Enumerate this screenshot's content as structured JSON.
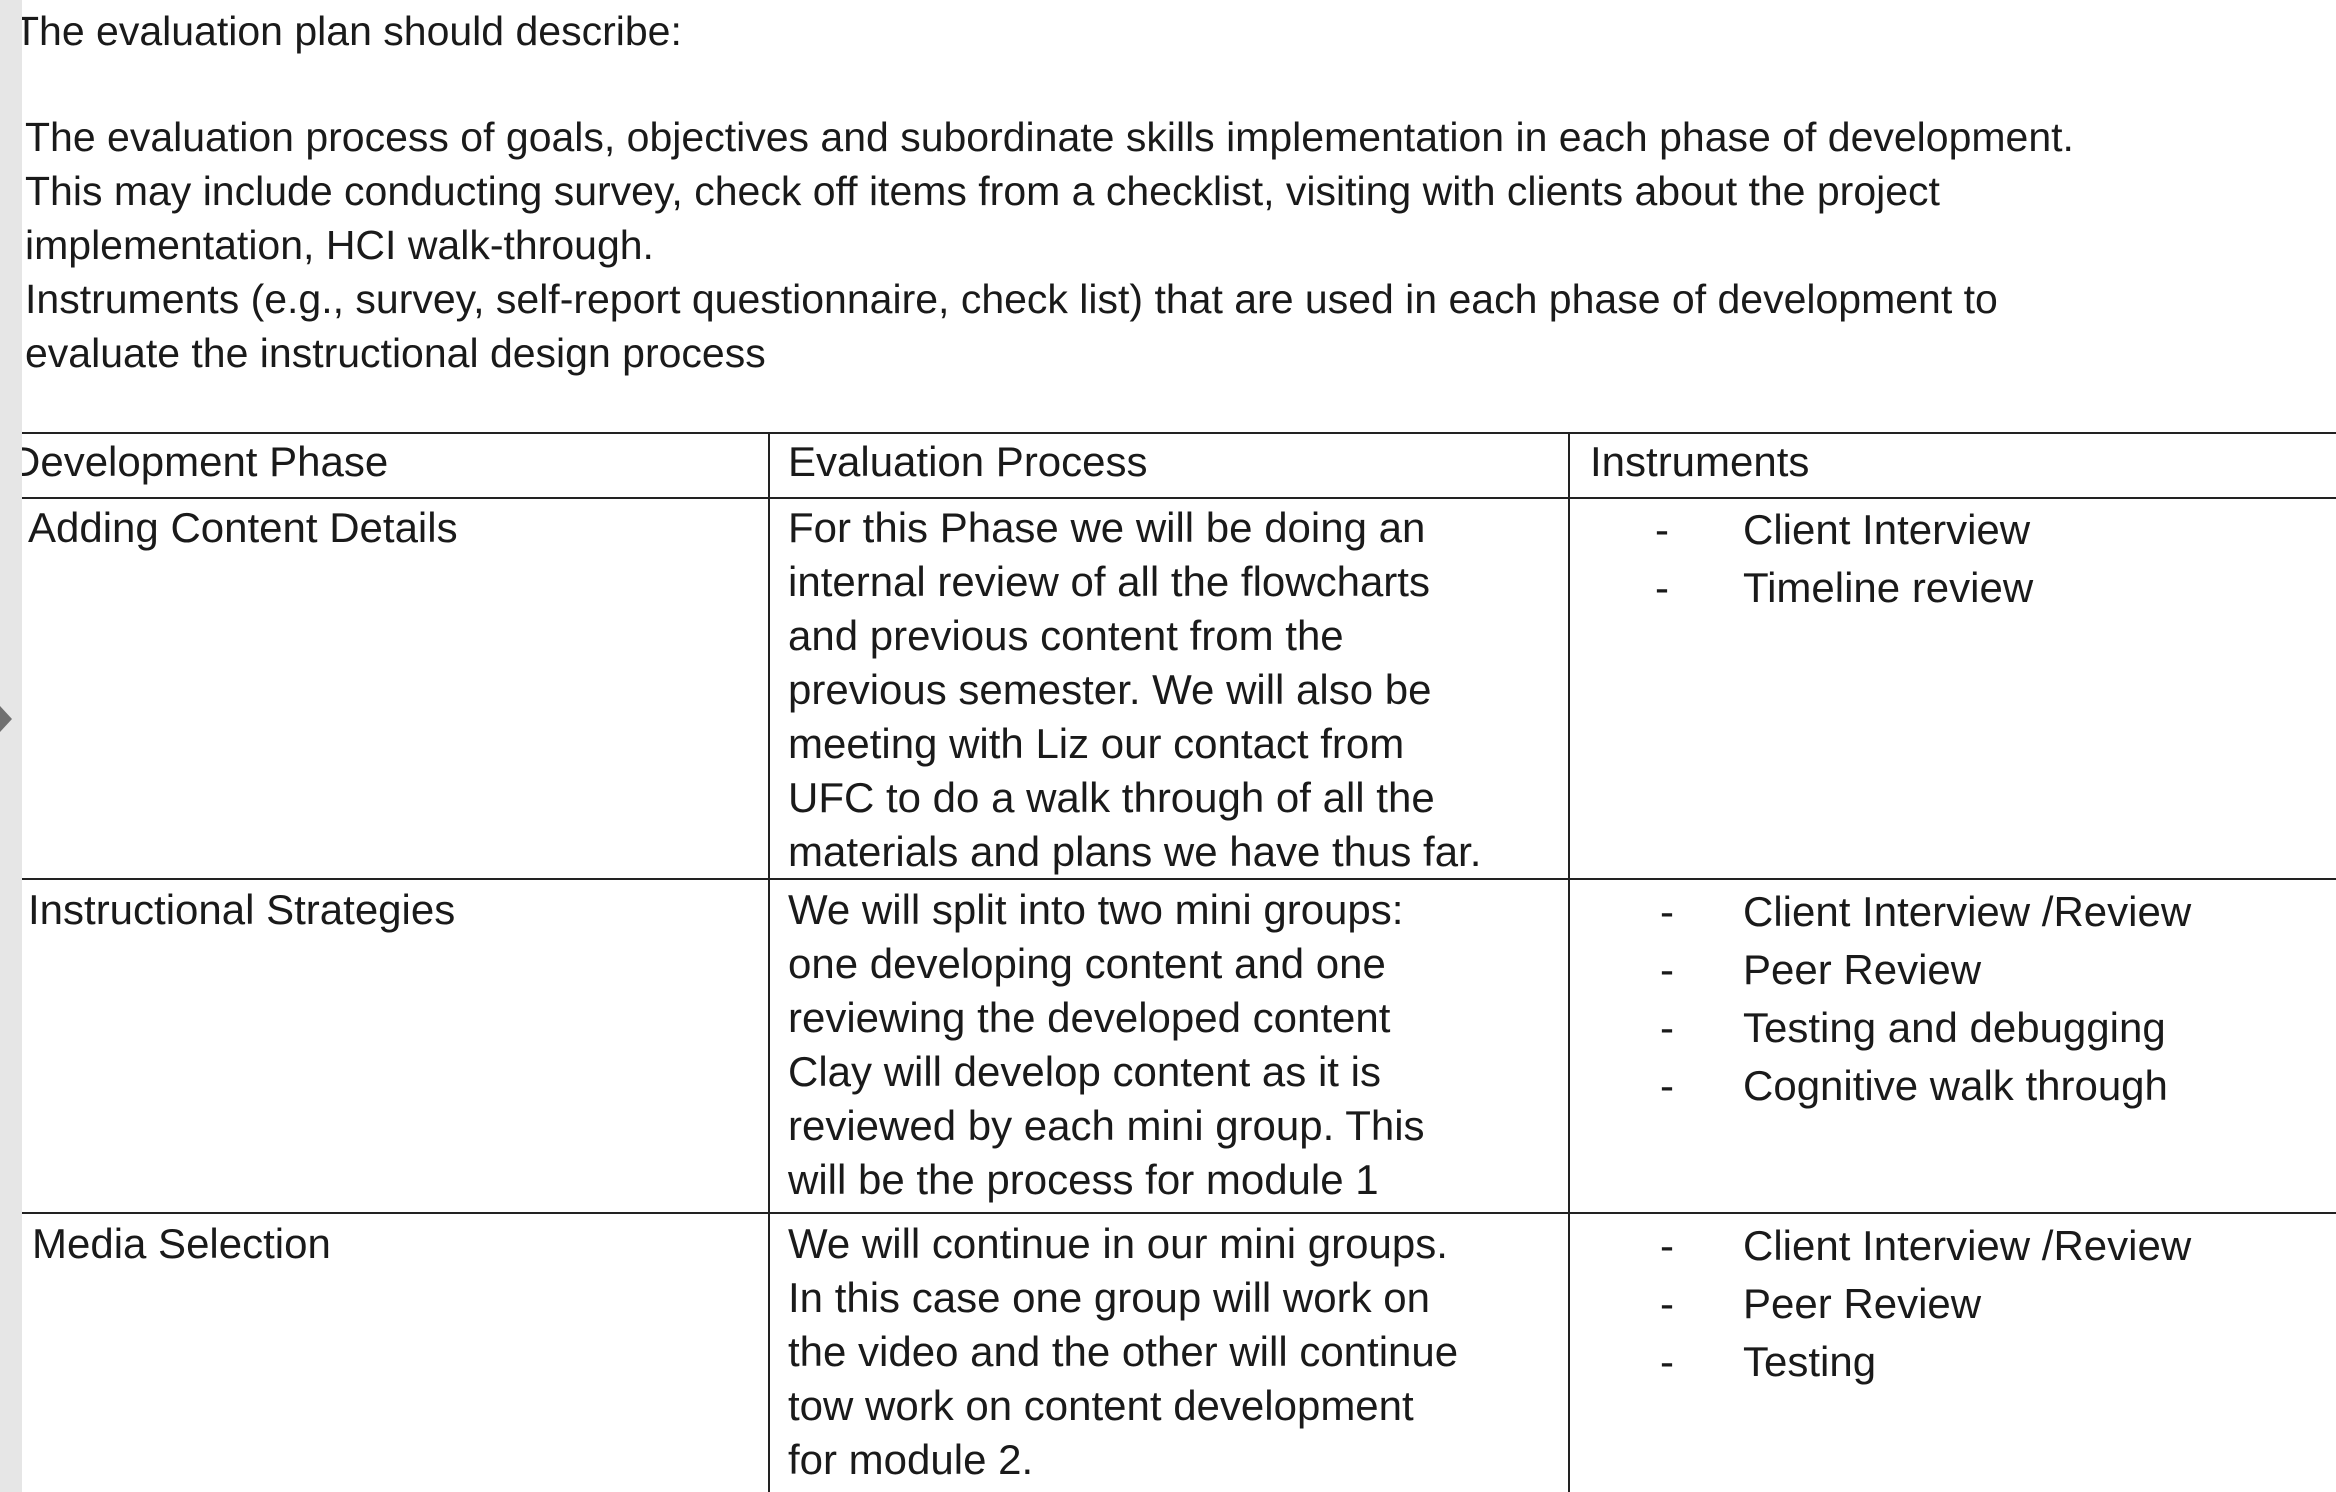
{
  "intro": {
    "heading": "The evaluation plan should describe:",
    "lines": [
      "The evaluation process of goals, objectives and subordinate skills implementation in each phase of development.",
      "This may include conducting survey, check off items from a checklist, visiting with clients about the project",
      "implementation, HCI walk-through.",
      "Instruments (e.g., survey, self-report questionnaire, check list) that are used in each phase of development to",
      "evaluate the instructional design process"
    ]
  },
  "table": {
    "headers": [
      "Development Phase",
      "Evaluation Process",
      "Instruments"
    ],
    "rows": [
      {
        "phase": "Adding Content Details",
        "process_lines": [
          "For this Phase we will be doing an",
          "internal review of all the flowcharts",
          "and previous content from the",
          "previous semester. We will also be",
          "meeting with Liz our contact from",
          "UFC to do a walk through of all the",
          "materials and plans we have thus far."
        ],
        "instruments": [
          "Client Interview",
          "Timeline review"
        ]
      },
      {
        "phase": "Instructional Strategies",
        "process_lines": [
          "We will split into two mini groups:",
          "one developing content and one",
          "reviewing the developed content",
          "Clay will develop content as it is",
          "reviewed by each mini group. This",
          "will be the process for module 1"
        ],
        "instruments": [
          "Client Interview /Review",
          "Peer Review",
          "Testing and debugging",
          "Cognitive walk through"
        ]
      },
      {
        "phase": "Media Selection",
        "process_lines": [
          "We will continue in our mini groups.",
          "In this case one group will work on",
          "the video and the other will continue",
          "tow work on content development",
          "for module 2."
        ],
        "instruments": [
          "Client Interview /Review",
          "Peer Review",
          "Testing"
        ]
      }
    ],
    "bullet_symbol": "-"
  }
}
